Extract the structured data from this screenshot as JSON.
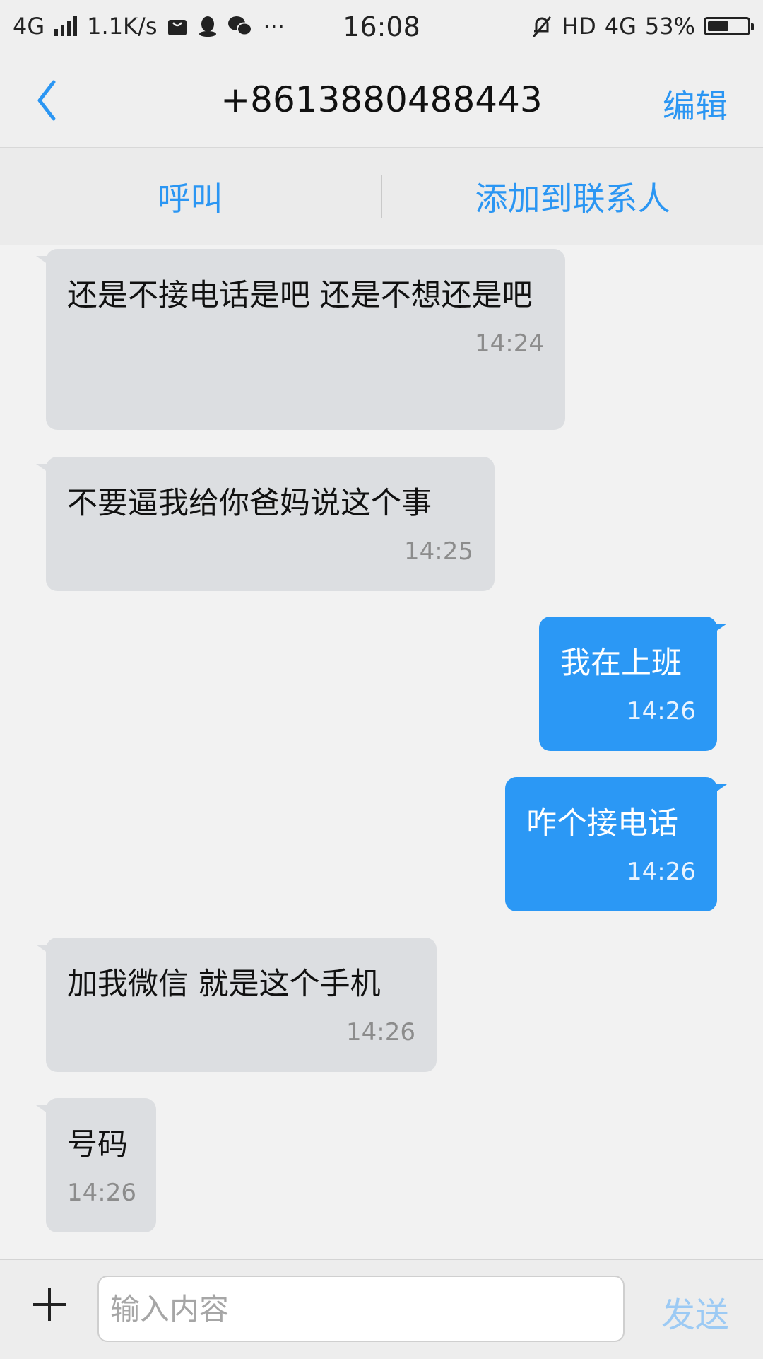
{
  "status_bar": {
    "network": "4G",
    "speed": "1.1K/s",
    "more": "···",
    "time": "16:08",
    "hd": "HD",
    "network2": "4G",
    "battery_percent": "53%",
    "battery_level": 0.53
  },
  "header": {
    "title": "+8613880488443",
    "edit_label": "编辑"
  },
  "actions": {
    "call_label": "呼叫",
    "add_contact_label": "添加到联系人"
  },
  "messages": [
    {
      "direction": "incoming",
      "text": "还是不接电话是吧 还是不想还是吧",
      "time": "14:24"
    },
    {
      "direction": "incoming",
      "text": "不要逼我给你爸妈说这个事",
      "time": "14:25"
    },
    {
      "direction": "outgoing",
      "text": "我在上班",
      "time": "14:26"
    },
    {
      "direction": "outgoing",
      "text": "咋个接电话",
      "time": "14:26"
    },
    {
      "direction": "incoming",
      "text": "加我微信 就是这个手机",
      "time": "14:26"
    },
    {
      "direction": "incoming",
      "text": "号码",
      "time": "14:26"
    }
  ],
  "composer": {
    "placeholder": "输入内容",
    "value": "",
    "send_label": "发送"
  },
  "colors": {
    "accent": "#2b96f3",
    "outgoing_bubble": "#2b98f5",
    "incoming_bubble": "#dcdee1",
    "send_disabled": "#9ccaf4"
  }
}
